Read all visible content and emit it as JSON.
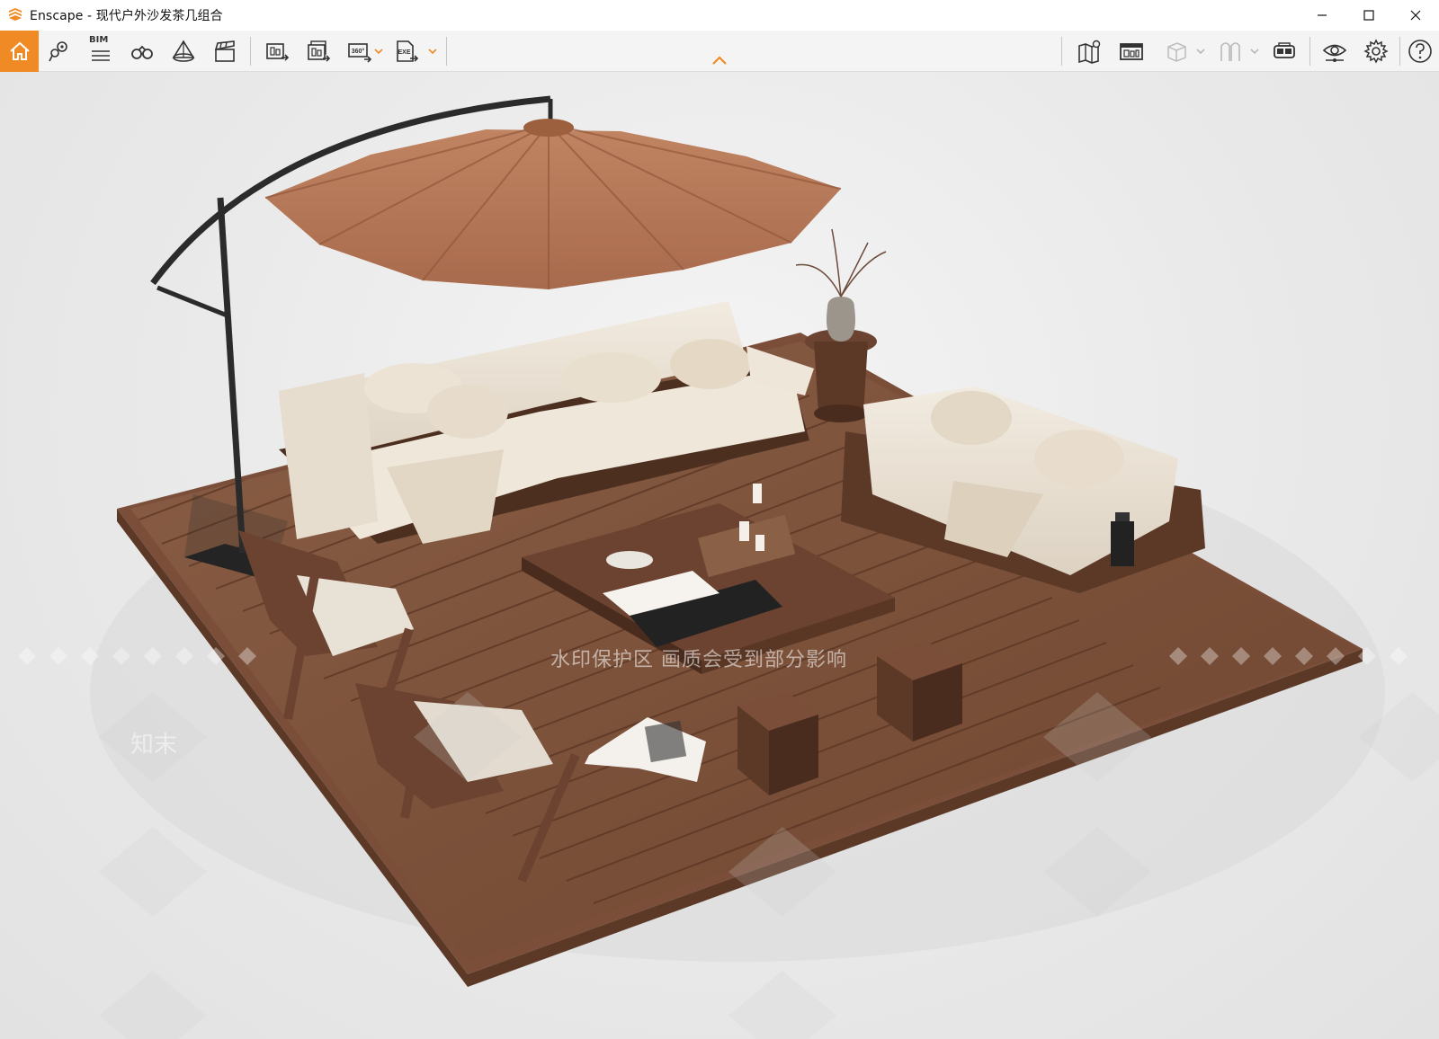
{
  "window": {
    "title": "Enscape - 现代户外沙发茶几组合",
    "controls": [
      "minimize",
      "maximize",
      "close"
    ]
  },
  "toolbar": {
    "accent_color": "#f08a24",
    "left_tools": [
      {
        "name": "home-icon",
        "label": "Home"
      },
      {
        "name": "location-icon",
        "label": "Views"
      },
      {
        "name": "bim-icon",
        "label": "BIM"
      },
      {
        "name": "binoculars-icon",
        "label": "Look around"
      },
      {
        "name": "visual-settings-icon",
        "label": "Assets"
      },
      {
        "name": "video-editor-icon",
        "label": "Video Editor"
      },
      {
        "name": "screenshot-icon",
        "label": "Screenshot"
      },
      {
        "name": "batch-render-icon",
        "label": "Batch Render"
      },
      {
        "name": "panorama-icon",
        "label": "360"
      },
      {
        "name": "export-exe-icon",
        "label": "EXE"
      }
    ],
    "bim_label": "BIM",
    "right_tools": [
      {
        "name": "map-icon",
        "label": "Map"
      },
      {
        "name": "render-gallery-icon",
        "label": "Gallery"
      },
      {
        "name": "cube-icon",
        "label": "Cube"
      },
      {
        "name": "xray-icon",
        "label": "X-Ray"
      },
      {
        "name": "vr-headset-icon",
        "label": "VR"
      },
      {
        "name": "eye-icon",
        "label": "Visual Settings"
      },
      {
        "name": "gear-icon",
        "label": "Settings"
      },
      {
        "name": "help-icon",
        "label": "Help"
      }
    ]
  },
  "viewport": {
    "watermark_text": "水印保护区  画质会受到部分影响",
    "watermark_logo": "知末"
  }
}
